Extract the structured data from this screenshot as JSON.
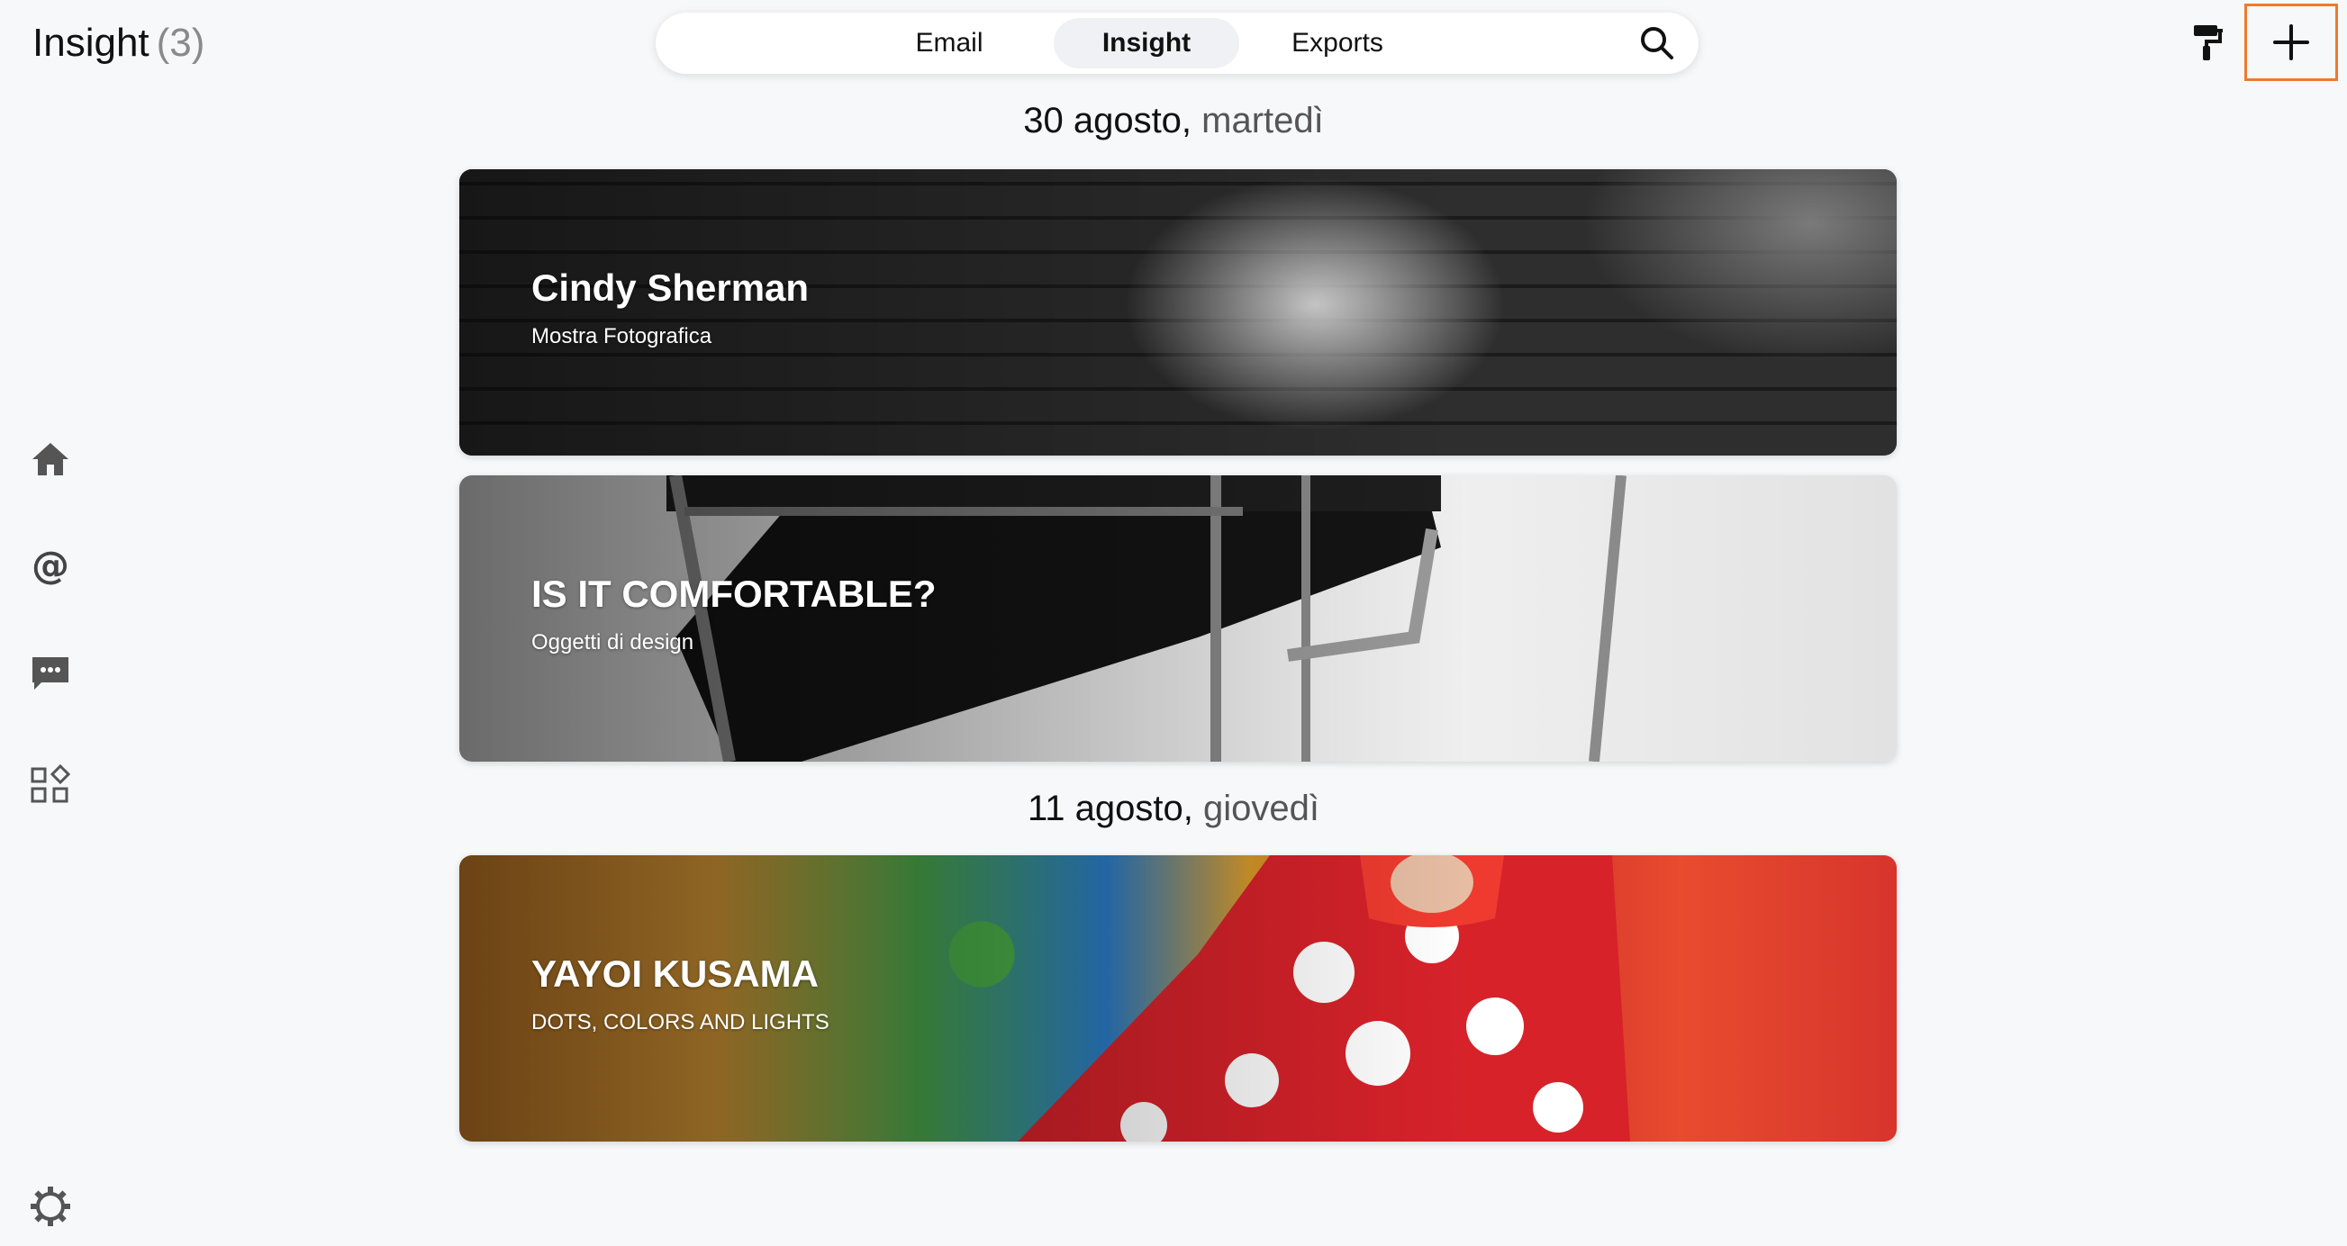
{
  "header": {
    "title": "Insight",
    "count": "(3)"
  },
  "tabs": [
    {
      "label": "Email"
    },
    {
      "label": "Insight"
    },
    {
      "label": "Exports"
    }
  ],
  "active_tab": "Insight",
  "accent_color": "#ee7a2e",
  "icons": {
    "search": "search-icon",
    "brush": "paint-roller-icon",
    "add": "plus-icon",
    "home": "home-icon",
    "mentions": "at-sign-icon",
    "chat": "chat-icon",
    "apps": "apps-grid-icon",
    "settings": "gear-icon"
  },
  "days": [
    {
      "date": "30 agosto",
      "separator": ",",
      "weekday": " martedì",
      "cards": [
        {
          "title": "Cindy Sherman",
          "subtitle": "Mostra Fotografica"
        },
        {
          "title": "IS IT COMFORTABLE?",
          "subtitle": "Oggetti di design"
        }
      ]
    },
    {
      "date": "11 agosto",
      "separator": ",",
      "weekday": " giovedì",
      "cards": [
        {
          "title": "YAYOI KUSAMA",
          "subtitle": "DOTS, COLORS AND LIGHTS"
        }
      ]
    }
  ]
}
